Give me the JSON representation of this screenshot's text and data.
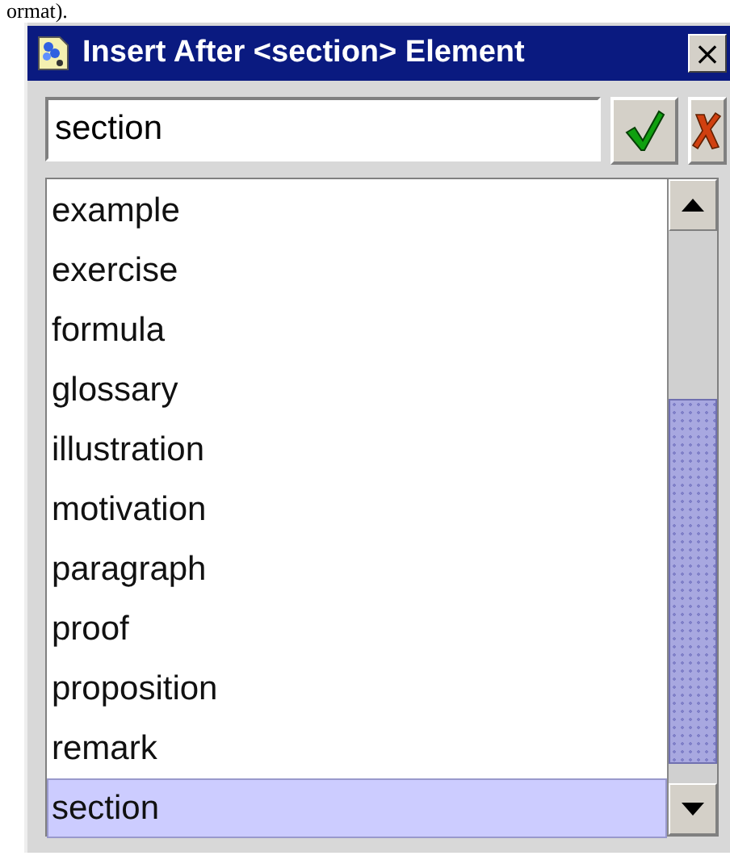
{
  "context_text": "ormat).",
  "window": {
    "title": "Insert After <section> Element",
    "close": "×"
  },
  "field": {
    "value": "section"
  },
  "list": {
    "items": [
      {
        "label": "example",
        "selected": false
      },
      {
        "label": "exercise",
        "selected": false
      },
      {
        "label": "formula",
        "selected": false
      },
      {
        "label": "glossary",
        "selected": false
      },
      {
        "label": "illustration",
        "selected": false
      },
      {
        "label": "motivation",
        "selected": false
      },
      {
        "label": "paragraph",
        "selected": false
      },
      {
        "label": "proof",
        "selected": false
      },
      {
        "label": "proposition",
        "selected": false
      },
      {
        "label": "remark",
        "selected": false
      },
      {
        "label": "section",
        "selected": true
      }
    ]
  }
}
